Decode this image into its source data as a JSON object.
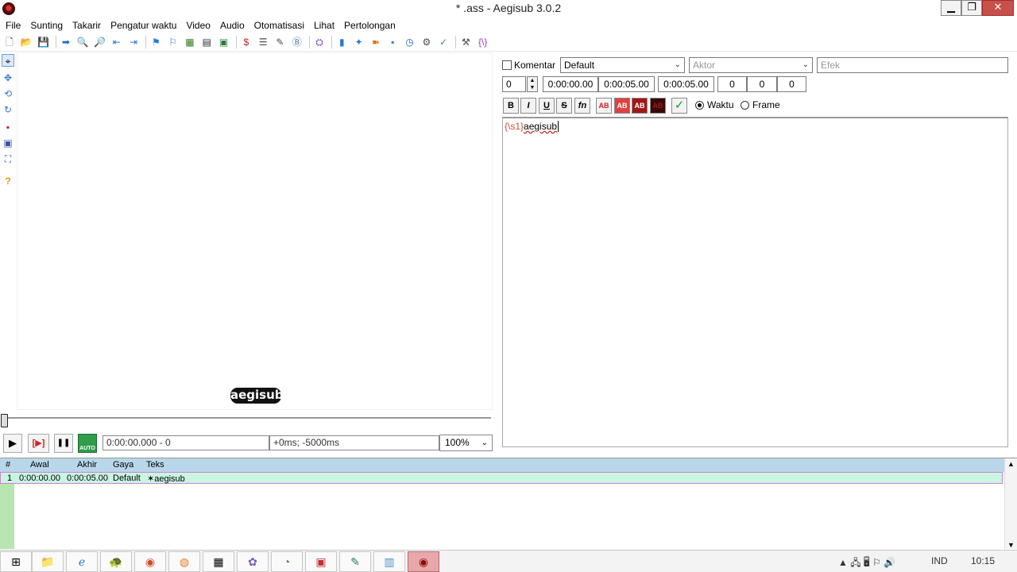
{
  "window": {
    "title": "* .ass - Aegisub 3.0.2",
    "min_glyph": "▁",
    "restore_glyph": "❐",
    "close_glyph": "✕"
  },
  "menu": [
    "File",
    "Sunting",
    "Takarir",
    "Pengatur waktu",
    "Video",
    "Audio",
    "Otomatisasi",
    "Lihat",
    "Pertolongan"
  ],
  "toolbar": {
    "icons": [
      "new-file-icon",
      "open-file-icon",
      "save-file-icon",
      "sep",
      "jump-to-icon",
      "zoom-in-icon",
      "zoom-out-icon",
      "video-snap-icon",
      "audio-snap-icon",
      "sep",
      "select-start-icon",
      "select-end-icon",
      "video-details-icon",
      "keyframes-icon",
      "timing-icon",
      "sep",
      "styles-manager-icon",
      "properties-icon",
      "attachments-icon",
      "fonts-collector-icon",
      "sep",
      "automation-icon",
      "sep",
      "resample-icon",
      "translation-icon",
      "kanji-icon",
      "timing-postprocessor-icon",
      "shift-times-icon",
      "assistant-icon",
      "spell-checker-icon",
      "sep",
      "options-icon",
      "tag-toggle-icon"
    ],
    "glyphs": [
      "🗋",
      "📂",
      "💾",
      "",
      "➡",
      "🔍",
      "🔎",
      "⇤",
      "⇥",
      "",
      "⚑",
      "⚐",
      "▦",
      "▤",
      "▣",
      "",
      "$",
      "☰",
      "✎",
      "Ⓑ",
      "",
      "⛭",
      "",
      "▮",
      "✦",
      "➽",
      "▪",
      "◷",
      "⚙",
      "✓",
      "",
      "⚒",
      "{\\}"
    ]
  },
  "vtools": {
    "glyphs": [
      "⌖",
      "✥",
      "⟲",
      "↻",
      "▪",
      "▣",
      "⛶",
      "?"
    ]
  },
  "video": {
    "subtitle_text": "aegisub",
    "play_glyph": "▶",
    "play_line_glyph": "[▶]",
    "pause_glyph": "❚❚",
    "autoscroll_label": "AUTO",
    "time_field": "0:00:00.000 - 0",
    "offset_field": "+0ms; -5000ms",
    "zoom_value": "100%"
  },
  "edit": {
    "comment_label": "Komentar",
    "style_value": "Default",
    "actor_placeholder": "Aktor",
    "effect_placeholder": "Efek",
    "layer_value": "0",
    "start_time": "0:00:00.00",
    "end_time": "0:00:05.00",
    "duration": "0:00:05.00",
    "margin_l": "0",
    "margin_r": "0",
    "margin_v": "0",
    "fmt_labels": [
      "B",
      "I",
      "U",
      "S",
      "fn",
      "AB",
      "AB",
      "AB",
      "AB"
    ],
    "commit_glyph": "✓",
    "radio_time_label": "Waktu",
    "radio_frame_label": "Frame",
    "text_tag": "{\\s1}",
    "text_body": "aegisub"
  },
  "grid": {
    "headers": [
      "#",
      "Awal",
      "Akhir",
      "Gaya",
      "Teks"
    ],
    "rows": [
      {
        "num": "1",
        "start": "0:00:00.00",
        "end": "0:00:05.00",
        "style": "Default",
        "text": "✶aegisub"
      }
    ],
    "scroll_up": "▲",
    "scroll_down": "▼"
  },
  "taskbar": {
    "apps": [
      "⊞",
      "📁",
      "ℯ",
      "🐢",
      "◉",
      "◍",
      "▦",
      "✿",
      "◔",
      "▣",
      "✎",
      "▥",
      "◉"
    ],
    "tray_glyphs": "▲ 🖧 🖥 ⚐ 🔊",
    "language": "IND",
    "clock": "10:15"
  }
}
